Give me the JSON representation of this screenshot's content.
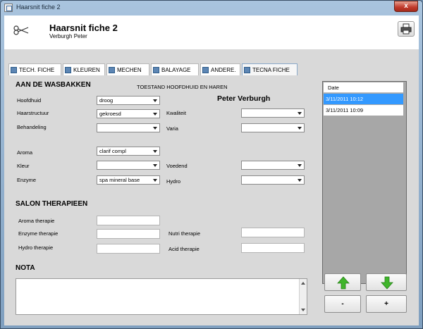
{
  "window": {
    "title": "Haarsnit fiche 2",
    "close_label": "x"
  },
  "header": {
    "title": "Haarsnit fiche 2",
    "subtitle": "Verburgh Peter"
  },
  "tabs": [
    {
      "label": "TECH. FICHE"
    },
    {
      "label": "KLEUREN"
    },
    {
      "label": "MECHEN"
    },
    {
      "label": "BALAYAGE"
    },
    {
      "label": "ANDERE."
    },
    {
      "label": "TECNA FICHE",
      "active": true
    }
  ],
  "wasbakken": {
    "heading": "AAN DE WASBAKKEN",
    "toestand": "TOESTAND HOOFDHUID EN HAREN",
    "client_name": "Peter Verburgh",
    "hoofdhuid": {
      "label": "Hoofdhuid",
      "value": "droog"
    },
    "haarstructuur": {
      "label": "Haarstructuur",
      "value": "gekroesd"
    },
    "behandeling": {
      "label": "Behandeling",
      "value": ""
    },
    "kwaliteit": {
      "label": "Kwaliteit",
      "value": ""
    },
    "varia": {
      "label": "Varia",
      "value": ""
    },
    "aroma": {
      "label": "Aroma",
      "value": "clarif compl"
    },
    "kleur": {
      "label": "Kleur",
      "value": ""
    },
    "voedend": {
      "label": "Voedend",
      "value": ""
    },
    "enzyme": {
      "label": "Enzyme",
      "value": "spa mineral base"
    },
    "hydro": {
      "label": "Hydro",
      "value": ""
    }
  },
  "therapieen": {
    "heading": "SALON THERAPIEEN",
    "aroma": {
      "label": "Aroma therapie",
      "value": ""
    },
    "enzyme": {
      "label": "Enzyme therapie",
      "value": ""
    },
    "hydro": {
      "label": "Hydro therapie",
      "value": ""
    },
    "nutri": {
      "label": "Nutri therapie",
      "value": ""
    },
    "acid": {
      "label": "Acid therapie",
      "value": ""
    }
  },
  "nota": {
    "heading": "NOTA",
    "value": ""
  },
  "dates": {
    "header": "Date",
    "rows": [
      {
        "value": "3/11/2011 10:12",
        "selected": true
      },
      {
        "value": "3/11/2011 10:09",
        "selected": false
      }
    ]
  },
  "buttons": {
    "up_icon": "arrow-up-icon",
    "down_icon": "arrow-down-icon",
    "minus_label": "-",
    "plus_label": "+"
  },
  "colors": {
    "accent": "#3399ff",
    "arrow_green": "#3fb52a",
    "close_red": "#c0392b"
  }
}
